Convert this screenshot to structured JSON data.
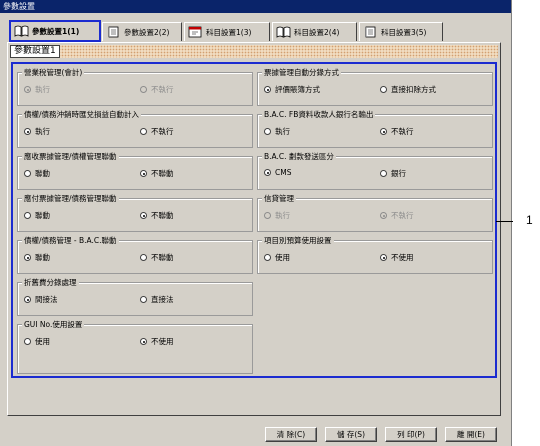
{
  "window": {
    "title": "參數設置"
  },
  "tabs": [
    {
      "label": "參數設置1(1)",
      "icon": "book-icon"
    },
    {
      "label": "參數設置2(2)",
      "icon": "notebook-icon"
    },
    {
      "label": "科目設置1(3)",
      "icon": "card-icon"
    },
    {
      "label": "科目設置2(4)",
      "icon": "book-icon"
    },
    {
      "label": "科目設置3(5)",
      "icon": "notebook-icon"
    }
  ],
  "section": {
    "title": "參數設置1"
  },
  "groups": {
    "g1": {
      "title": "營業稅管理(會計)",
      "opt1": "執行",
      "opt2": "不執行"
    },
    "g2": {
      "title": "票據管理自動分錄方式",
      "opt1": "評價賬簿方式",
      "opt2": "直接扣除方式"
    },
    "g3": {
      "title": "債權/債務沖銷時匯兌損益自動計入",
      "opt1": "執行",
      "opt2": "不執行"
    },
    "g4": {
      "title": "B.A.C. FB資料收款人銀行名輸出",
      "opt1": "執行",
      "opt2": "不執行"
    },
    "g5": {
      "title": "應收票據管理/債權管理聯動",
      "opt1": "聯動",
      "opt2": "不聯動"
    },
    "g6": {
      "title": "B.A.C. 劃款發送區分",
      "opt1": "CMS",
      "opt2": "銀行"
    },
    "g7": {
      "title": "應付票據管理/債務管理聯動",
      "opt1": "聯動",
      "opt2": "不聯動"
    },
    "g8": {
      "title": "信貸管理",
      "opt1": "執行",
      "opt2": "不執行"
    },
    "g9": {
      "title": "債權/債務管理 - B.A.C.聯動",
      "opt1": "聯動",
      "opt2": "不聯動"
    },
    "g10": {
      "title": "項目別預算使用設置",
      "opt1": "使用",
      "opt2": "不使用"
    },
    "g11": {
      "title": "折舊費分錄處理",
      "opt1": "間接法",
      "opt2": "直接法"
    },
    "g12": {
      "title": "GUI No.使用設置",
      "opt1": "使用",
      "opt2": "不使用"
    }
  },
  "buttons": {
    "clear": "清 除(C)",
    "save": "儲 存(S)",
    "print": "列 印(P)",
    "close": "離 開(E)"
  },
  "callout": {
    "label": "1"
  },
  "colors": {
    "title_bar": "#0a246a",
    "highlight": "#1b2bd0",
    "face": "#d4d0c8"
  }
}
